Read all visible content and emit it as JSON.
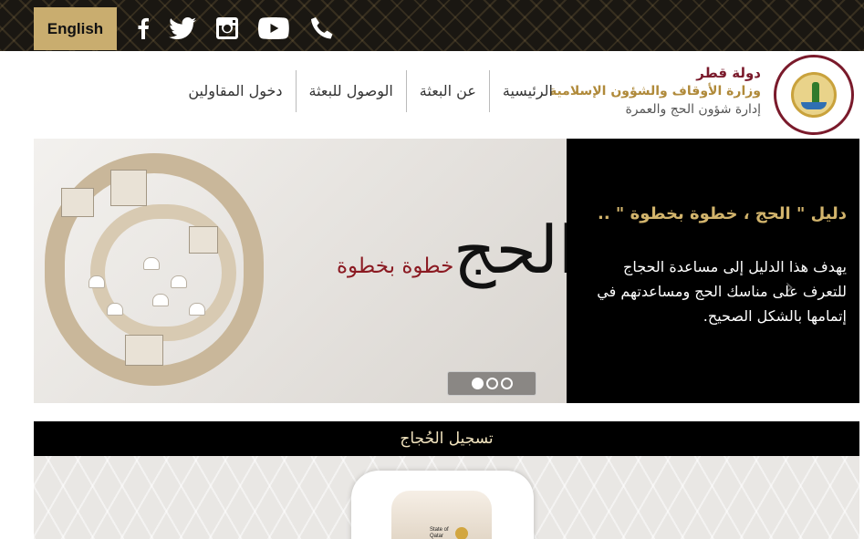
{
  "topbar": {
    "language_label": "English",
    "social": [
      "facebook-icon",
      "twitter-icon",
      "instagram-icon",
      "youtube-icon",
      "phone-icon"
    ]
  },
  "header": {
    "org_line1": "دولة قطر",
    "org_line2": "وزارة الأوقاف والشؤون الإسلامية",
    "org_line3": "إدارة شؤون الحج والعمرة",
    "nav": [
      "الرئيسية",
      "عن البعثة",
      "الوصول للبعثة",
      "دخول المقاولين"
    ]
  },
  "banner": {
    "title": "دليل \" الحج ، خطوة بخطوة \" ..",
    "text": "يهدف هذا الدليل إلى مساعدة الحجاج للتعرف على مناسك الحج ومساعدتهم في إتمامها بالشكل الصحيح.",
    "art_word": "الحج",
    "art_subtitle": "خطوة بخطوة",
    "slides": 3,
    "active_slide": 1
  },
  "registration": {
    "title": "تسجيل الحُجاج",
    "card_text": "State of Qatar"
  },
  "colors": {
    "gold": "#c9ad6f",
    "maroon": "#7a1a2b",
    "black": "#000000"
  }
}
